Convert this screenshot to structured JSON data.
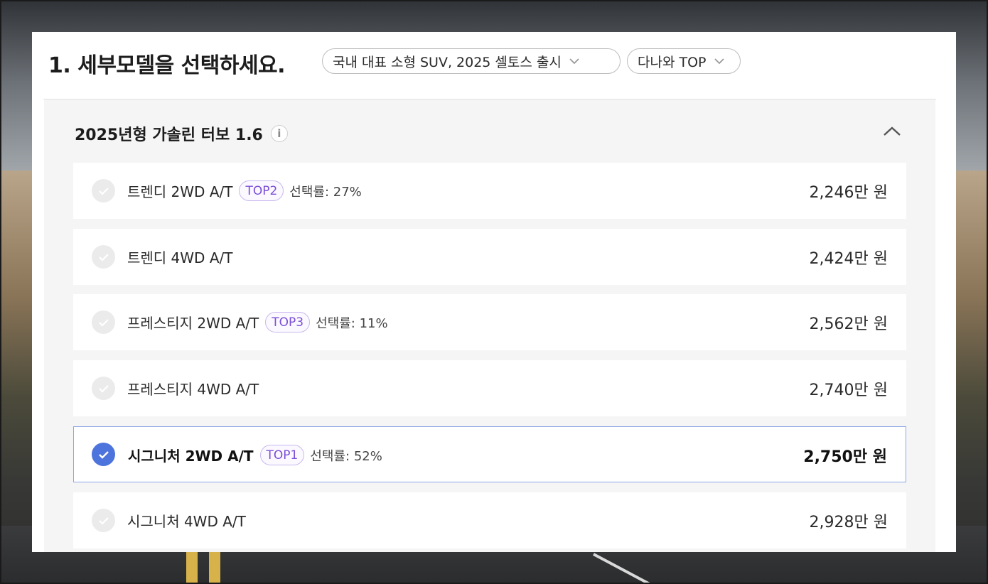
{
  "header": {
    "title": "1. 세부모델을 선택하세요.",
    "model_select": {
      "value": "국내 대표 소형 SUV, 2025 셀토스 출시",
      "icon": "chevron-down-icon"
    },
    "sort_select": {
      "value": "다나와 TOP",
      "icon": "chevron-down-icon"
    }
  },
  "section": {
    "title": "2025년형 가솔린 터보 1.6",
    "info_icon": "i",
    "collapse_icon": "chevron-up-icon"
  },
  "trims": [
    {
      "name": "트렌디 2WD A/T",
      "badge": "TOP2",
      "rate": "선택률: 27%",
      "price": "2,246만 원",
      "selected": false
    },
    {
      "name": "트렌디 4WD A/T",
      "badge": "",
      "rate": "",
      "price": "2,424만 원",
      "selected": false
    },
    {
      "name": "프레스티지 2WD A/T",
      "badge": "TOP3",
      "rate": "선택률: 11%",
      "price": "2,562만 원",
      "selected": false
    },
    {
      "name": "프레스티지 4WD A/T",
      "badge": "",
      "rate": "",
      "price": "2,740만 원",
      "selected": false
    },
    {
      "name": "시그니처 2WD A/T",
      "badge": "TOP1",
      "rate": "선택률: 52%",
      "price": "2,750만 원",
      "selected": true
    },
    {
      "name": "시그니처 4WD A/T",
      "badge": "",
      "rate": "",
      "price": "2,928만 원",
      "selected": false
    }
  ],
  "colors": {
    "accent": "#4d73dc",
    "badge": "#7b4fd7",
    "selected_border": "#8ea6e6"
  }
}
